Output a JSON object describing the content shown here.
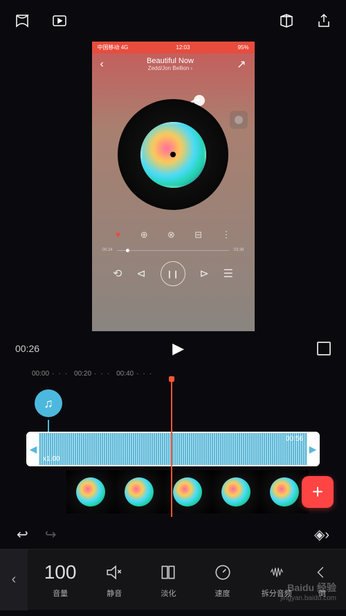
{
  "preview": {
    "status_bar": {
      "carrier": "中国移动 4G",
      "time": "12:03",
      "battery": "95%"
    },
    "song_title": "Beautiful Now",
    "song_artist": "Zedd/Jon Bellion ›",
    "progress_start": "00:24",
    "progress_end": "03:38"
  },
  "timeline": {
    "current_time": "00:26",
    "ruler_marks": [
      "00:00",
      "00:20",
      "00:40"
    ],
    "clip_duration": "00:56",
    "clip_speed": "x1.00"
  },
  "toolbar": {
    "volume_value": "100",
    "volume_label": "音量",
    "mute_label": "静音",
    "fade_label": "淡化",
    "speed_label": "速度",
    "detach_label": "拆分音频",
    "reverse_label": "倒"
  },
  "watermark": {
    "brand": "Baidu 经验",
    "url": "jingyan.baidu.com"
  }
}
